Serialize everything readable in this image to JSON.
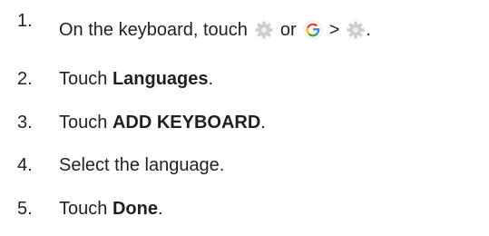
{
  "steps": [
    {
      "number": "1.",
      "pre": "On the keyboard, touch",
      "or": "or",
      "gt": ">",
      "end": ".",
      "icons": [
        "gear-icon",
        "google-g-icon",
        "gear-icon"
      ]
    },
    {
      "number": "2.",
      "pre": "Touch ",
      "bold": "Languages",
      "post": "."
    },
    {
      "number": "3.",
      "pre": "Touch ",
      "bold": "ADD KEYBOARD",
      "post": "."
    },
    {
      "number": "4.",
      "text": "Select the language."
    },
    {
      "number": "5.",
      "pre": "Touch ",
      "bold": "Done",
      "post": "."
    }
  ],
  "colors": {
    "text": "#231f20",
    "gear": "#cfcfcf",
    "google_blue": "#4285F4",
    "google_red": "#EA4335",
    "google_yellow": "#FBBC05",
    "google_green": "#34A853"
  }
}
